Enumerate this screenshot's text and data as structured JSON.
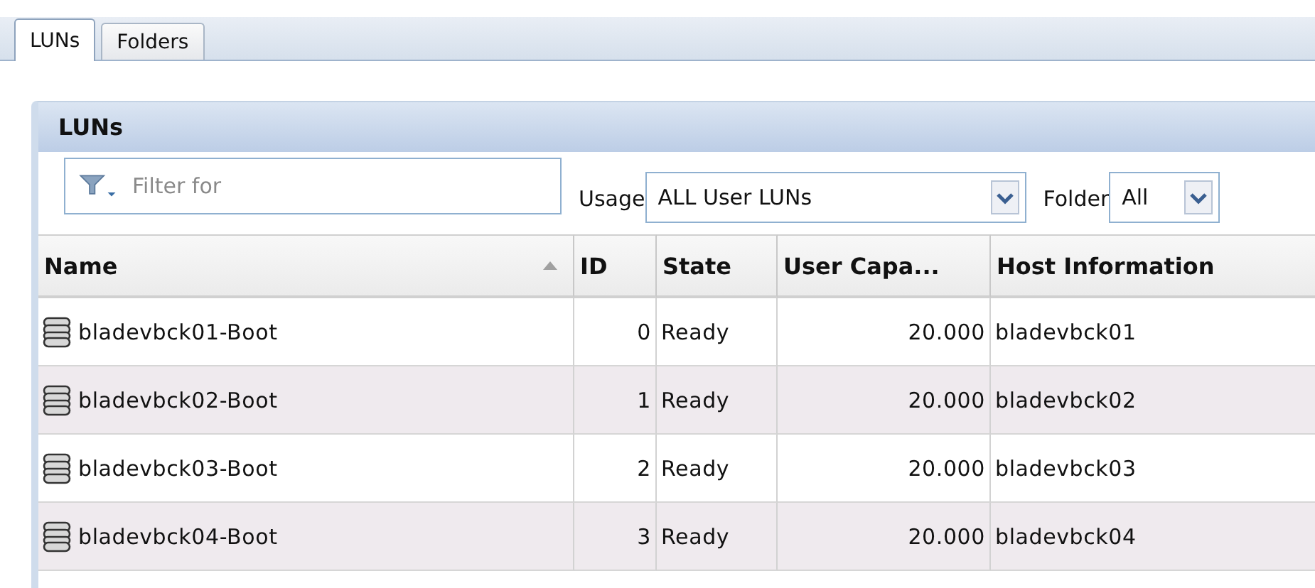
{
  "tabs": [
    {
      "label": "LUNs",
      "selected": true
    },
    {
      "label": "Folders",
      "selected": false
    }
  ],
  "panel": {
    "title": "LUNs",
    "filter": {
      "placeholder": "Filter for"
    },
    "usage": {
      "label": "Usage",
      "value": "ALL User LUNs"
    },
    "folder": {
      "label": "Folder",
      "value": "All"
    },
    "table": {
      "columns": [
        {
          "label": "Name",
          "sorted": true
        },
        {
          "label": "ID",
          "sorted": false
        },
        {
          "label": "State",
          "sorted": false
        },
        {
          "label": "User Capa...",
          "sorted": false
        },
        {
          "label": "Host Information",
          "sorted": false
        }
      ],
      "rows": [
        {
          "name": "bladevbck01-Boot",
          "id": "0",
          "state": "Ready",
          "capacity": "20.000",
          "host": "bladevbck01"
        },
        {
          "name": "bladevbck02-Boot",
          "id": "1",
          "state": "Ready",
          "capacity": "20.000",
          "host": "bladevbck02"
        },
        {
          "name": "bladevbck03-Boot",
          "id": "2",
          "state": "Ready",
          "capacity": "20.000",
          "host": "bladevbck03"
        },
        {
          "name": "bladevbck04-Boot",
          "id": "3",
          "state": "Ready",
          "capacity": "20.000",
          "host": "bladevbck04"
        }
      ]
    }
  }
}
